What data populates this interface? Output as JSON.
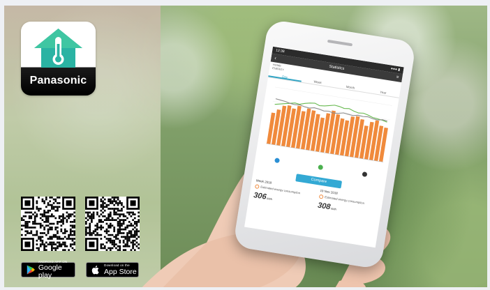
{
  "brand": {
    "name": "Panasonic",
    "icon": "house-thermometer-icon",
    "colors": {
      "house": "#2ab3a3",
      "house_top": "#3fc6a2",
      "thermo": "#ffffff",
      "black": "#000000"
    }
  },
  "qr_codes": [
    {
      "name": "qr-google-play",
      "icon": "qr-code-icon"
    },
    {
      "name": "qr-app-store",
      "icon": "qr-code-icon"
    }
  ],
  "store_badges": {
    "google": {
      "small": "ANDROID APP ON",
      "big": "Google play",
      "icon": "google-play-icon"
    },
    "apple": {
      "small": "Download on the",
      "big": "App Store",
      "icon": "apple-icon"
    }
  },
  "phone": {
    "status_time": "12:38",
    "status_right": "●●● ▮",
    "title": "Statistics",
    "subhead": [
      "HOME",
      "ENERGY"
    ],
    "tabs": [
      "Day",
      "Week",
      "Month",
      "Year"
    ],
    "active_tab": 0,
    "compare_label": "Compare",
    "left_card": {
      "date": "Week 2018",
      "desc": "Estimated energy consumption",
      "value": "306",
      "unit": "kWh"
    },
    "right_card": {
      "date": "19 Nov 2018",
      "desc": "Estimated energy consumption",
      "value": "308",
      "unit": "kWh"
    },
    "legend_colors": [
      "#2a8fd4",
      "#4bb04f",
      "#333333"
    ]
  },
  "chart_data": {
    "type": "bar",
    "values": [
      0.55,
      0.62,
      0.7,
      0.72,
      0.68,
      0.74,
      0.66,
      0.72,
      0.7,
      0.65,
      0.6,
      0.69,
      0.75,
      0.7,
      0.64,
      0.62,
      0.7,
      0.72,
      0.68,
      0.58,
      0.66,
      0.7,
      0.62,
      0.6
    ],
    "line_green": [
      0.7,
      0.72,
      0.74,
      0.76,
      0.78,
      0.77,
      0.8,
      0.82,
      0.83,
      0.8,
      0.81,
      0.83,
      0.85,
      0.84,
      0.82,
      0.83,
      0.8,
      0.78,
      0.79,
      0.77,
      0.74,
      0.73,
      0.72,
      0.7
    ],
    "line_gray": [
      0.8,
      0.79,
      0.78,
      0.76,
      0.75,
      0.76,
      0.74,
      0.73,
      0.75,
      0.74,
      0.72,
      0.73,
      0.71,
      0.72,
      0.74,
      0.73,
      0.72,
      0.74,
      0.73,
      0.74,
      0.72,
      0.71,
      0.73,
      0.72
    ],
    "bar_color": "#f08a3c",
    "line_colors": [
      "#67b94f",
      "#8c8c8c"
    ],
    "ylim": [
      0,
      1
    ]
  }
}
